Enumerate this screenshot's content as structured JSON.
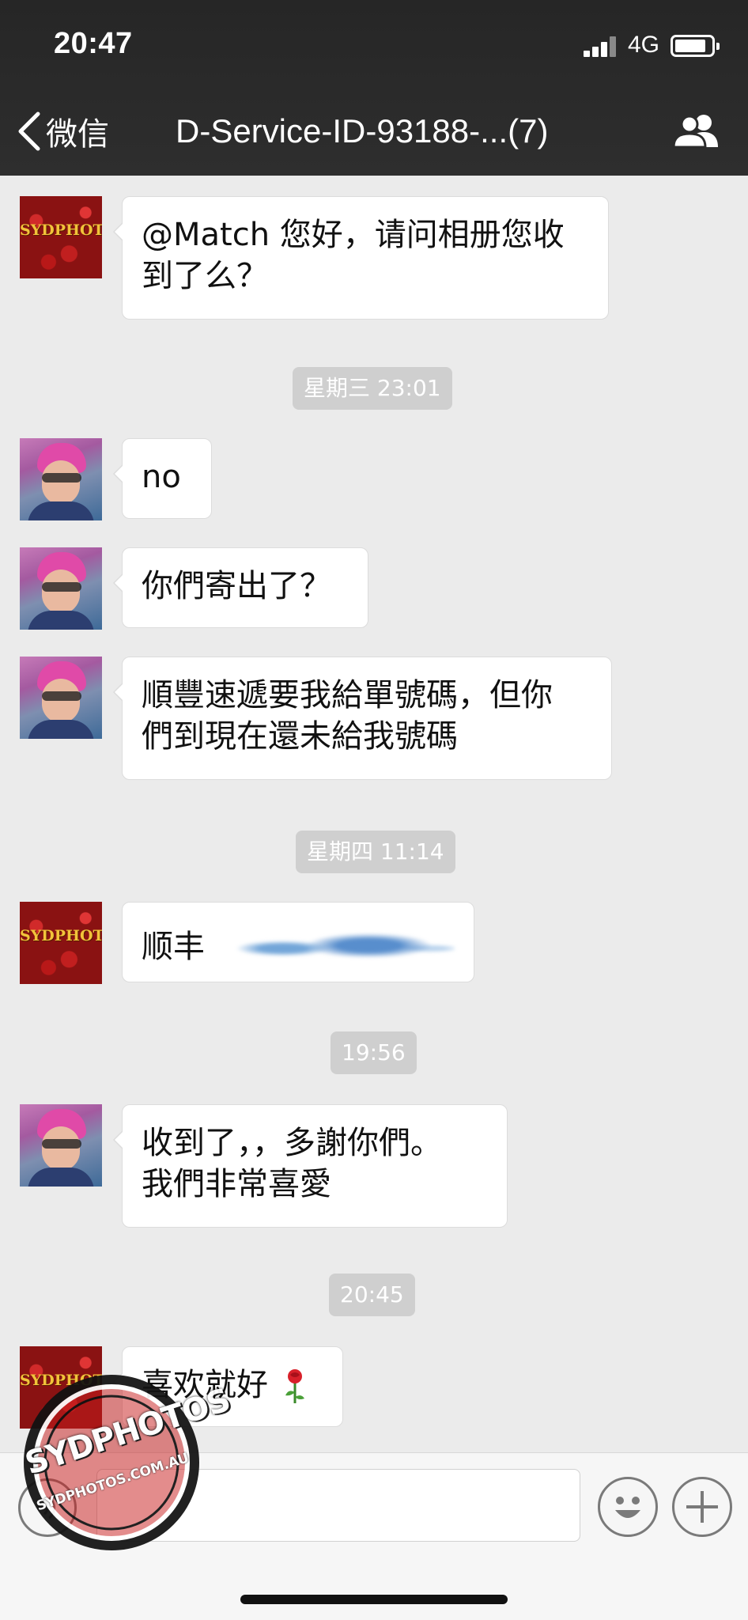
{
  "status_bar": {
    "time": "20:47",
    "network": "4G"
  },
  "nav": {
    "back_label": "微信",
    "title": "D-Service-ID-93188-...(7)"
  },
  "avatars": {
    "sydphotos_logo_text": "SYDPHOTOS"
  },
  "messages": [
    {
      "sender": "sydphotos",
      "text_lines": [
        "@Match 您好，请问相册您收",
        "到了么？"
      ]
    },
    {
      "timestamp": "星期三 23:01"
    },
    {
      "sender": "user",
      "text_lines": [
        "no"
      ]
    },
    {
      "sender": "user",
      "text_lines": [
        "你們寄出了？"
      ]
    },
    {
      "sender": "user",
      "text_lines": [
        "順豐速遞要我給單號碼，但你",
        "們到現在還未給我號碼"
      ]
    },
    {
      "timestamp": "星期四 11:14"
    },
    {
      "sender": "sydphotos",
      "text_lines": [
        "顺丰"
      ],
      "redacted": true
    },
    {
      "timestamp": "19:56"
    },
    {
      "sender": "user",
      "text_lines": [
        "收到了，，多謝你們。",
        "我們非常喜愛"
      ]
    },
    {
      "timestamp": "20:45"
    },
    {
      "sender": "sydphotos",
      "text_lines": [
        "喜欢就好"
      ],
      "emoji": "rose-icon"
    }
  ],
  "watermark": {
    "brand": "SYDPHOTOS",
    "url": "SYDPHOTOS.COM.AU"
  },
  "colors": {
    "header_bg": "#2b2b2b",
    "chat_bg": "#ebebeb",
    "bubble_bg": "#ffffff",
    "timestamp_bg": "#cfcfcf"
  }
}
